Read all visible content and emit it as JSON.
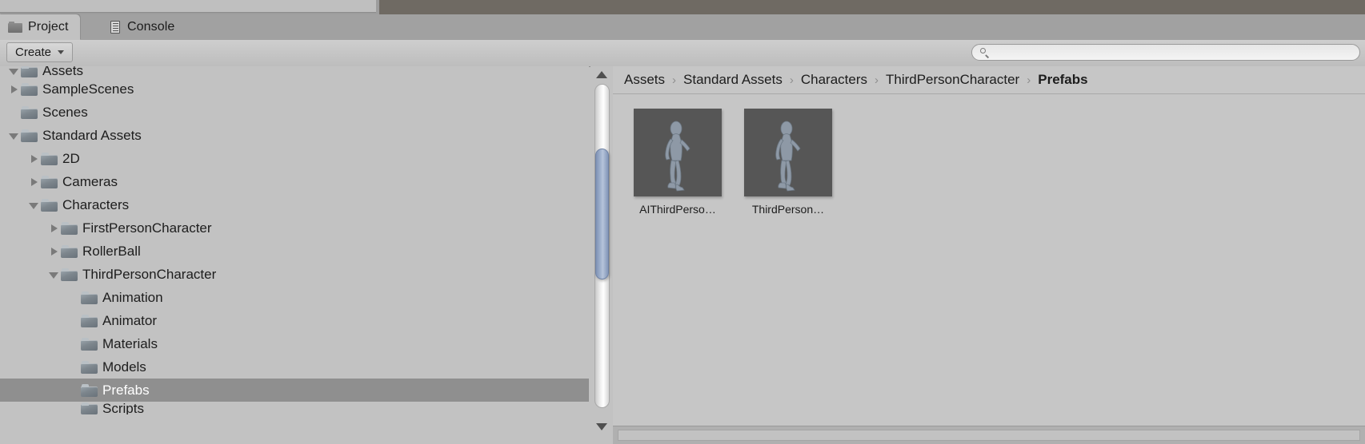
{
  "window": {
    "title": "Project"
  },
  "tabs": [
    {
      "label": "Project",
      "icon": "folder-icon",
      "active": true
    },
    {
      "label": "Console",
      "icon": "console-icon",
      "active": false
    }
  ],
  "toolbar": {
    "create_label": "Create",
    "create_caret": "caret-down-icon",
    "search": {
      "value": "",
      "placeholder": "",
      "icon": "search-icon"
    }
  },
  "tree": {
    "items": [
      {
        "label": "Assets",
        "depth": 1,
        "twisty": "open",
        "selected": false,
        "clipped": "top"
      },
      {
        "label": "SampleScenes",
        "depth": 1,
        "twisty": "closed",
        "selected": false
      },
      {
        "label": "Scenes",
        "depth": 1,
        "twisty": "none",
        "selected": false
      },
      {
        "label": "Standard Assets",
        "depth": 1,
        "twisty": "open",
        "selected": false
      },
      {
        "label": "2D",
        "depth": 2,
        "twisty": "closed",
        "selected": false
      },
      {
        "label": "Cameras",
        "depth": 2,
        "twisty": "closed",
        "selected": false
      },
      {
        "label": "Characters",
        "depth": 2,
        "twisty": "open",
        "selected": false
      },
      {
        "label": "FirstPersonCharacter",
        "depth": 3,
        "twisty": "closed",
        "selected": false
      },
      {
        "label": "RollerBall",
        "depth": 3,
        "twisty": "closed",
        "selected": false
      },
      {
        "label": "ThirdPersonCharacter",
        "depth": 3,
        "twisty": "open",
        "selected": false
      },
      {
        "label": "Animation",
        "depth": 4,
        "twisty": "none",
        "selected": false
      },
      {
        "label": "Animator",
        "depth": 4,
        "twisty": "none",
        "selected": false
      },
      {
        "label": "Materials",
        "depth": 4,
        "twisty": "none",
        "selected": false
      },
      {
        "label": "Models",
        "depth": 4,
        "twisty": "none",
        "selected": false
      },
      {
        "label": "Prefabs",
        "depth": 4,
        "twisty": "none",
        "selected": true
      },
      {
        "label": "Scripts",
        "depth": 4,
        "twisty": "none",
        "selected": false,
        "clipped": "bottom"
      }
    ]
  },
  "scrollbar": {
    "up_arrow": "triangle-up-icon",
    "down_arrow": "triangle-down-icon"
  },
  "breadcrumb": {
    "separator": "›",
    "items": [
      {
        "label": "Assets",
        "current": false
      },
      {
        "label": "Standard Assets",
        "current": false
      },
      {
        "label": "Characters",
        "current": false
      },
      {
        "label": "ThirdPersonCharacter",
        "current": false
      },
      {
        "label": "Prefabs",
        "current": true
      }
    ]
  },
  "assets": [
    {
      "label": "AIThirdPerso…",
      "thumbnail": "character-prefab-thumbnail"
    },
    {
      "label": "ThirdPerson…",
      "thumbnail": "character-prefab-thumbnail"
    }
  ],
  "colors": {
    "panel_bg": "#c2c2c2",
    "tab_active_bg": "#c2c2c2",
    "tab_bar_bg": "#a1a1a1",
    "selection_bg": "#8f8f8f",
    "selection_text": "#ffffff",
    "thumb_bg": "#565656",
    "scroll_thumb": "#8296b8",
    "text": "#1d1d1d"
  }
}
